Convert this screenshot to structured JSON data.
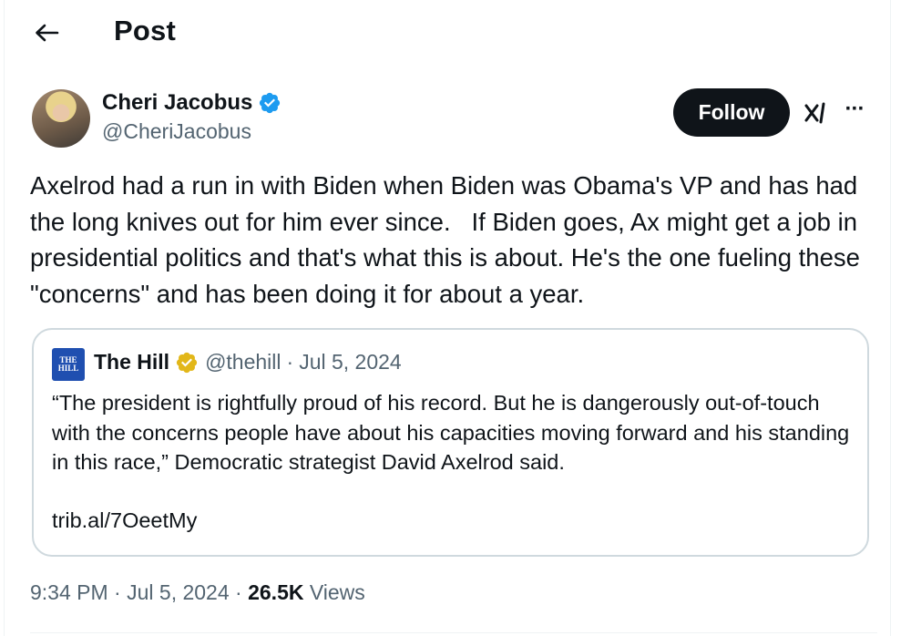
{
  "header": {
    "title": "Post",
    "back_icon": "arrow-left-icon"
  },
  "author": {
    "name": "Cheri Jacobus",
    "handle": "@CheriJacobus",
    "verified_color": "#1d9bf0"
  },
  "actions": {
    "follow_label": "Follow",
    "grok_icon": "grok-icon",
    "more_label": "···"
  },
  "tweet": {
    "text": "Axelrod had a run in with Biden when Biden was Obama's VP and has had the long knives out for him ever since.   If Biden goes, Ax might get a job in presidential politics and that's what this is about. He's the one fueling these \"concerns\" and has been doing it for about a year."
  },
  "quote": {
    "logo_line1": "THE",
    "logo_line2": "HILL",
    "name": "The Hill",
    "badge_color": "#e2b719",
    "handle": "@thehill",
    "separator": "·",
    "date": "Jul 5, 2024",
    "text": "“The president is rightfully proud of his record. But he is dangerously out-of-touch with the concerns people have about his capacities moving forward and his standing in this race,” Democratic strategist David Axelrod said.",
    "link": "trib.al/7OeetMy"
  },
  "meta": {
    "time": "9:34 PM",
    "separator": "·",
    "date": "Jul 5, 2024",
    "views_count": "26.5K",
    "views_label": "Views"
  },
  "colors": {
    "text": "#0f1419",
    "secondary": "#536471",
    "border": "#cfd9de"
  }
}
